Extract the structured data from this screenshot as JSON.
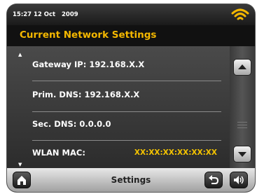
{
  "status": {
    "time": "15:27",
    "date": "12 Oct",
    "year": "2009",
    "wifi_icon": "wifi-signal-icon",
    "accent": "#f5b800"
  },
  "header": {
    "title": "Current Network Settings"
  },
  "list": {
    "items": [
      {
        "label": "Gateway IP: 192.168.X.X",
        "value": ""
      },
      {
        "label": "Prim. DNS: 192.168.X.X",
        "value": ""
      },
      {
        "label": "Sec. DNS: 0.0.0.0",
        "value": ""
      },
      {
        "label": "WLAN MAC:",
        "value": "XX:XX:XX:XX:XX:XX"
      }
    ]
  },
  "bottom": {
    "title": "Settings",
    "home_icon": "home-icon",
    "back_icon": "back-icon",
    "volume_icon": "volume-icon"
  }
}
